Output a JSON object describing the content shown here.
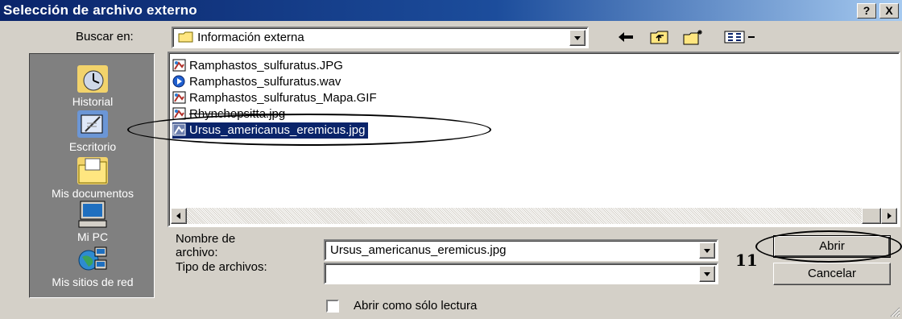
{
  "window": {
    "title": "Selección de archivo externo",
    "help_label": "?",
    "close_label": "X"
  },
  "look_in": {
    "label": "Buscar en:",
    "value": "Información externa"
  },
  "toolbar": {
    "back_icon": "back-arrow-icon",
    "up_icon": "up-folder-icon",
    "new_folder_icon": "new-folder-icon",
    "view_icon": "view-menu-icon"
  },
  "places": [
    {
      "label": "Historial",
      "icon": "history-icon"
    },
    {
      "label": "Escritorio",
      "icon": "desktop-icon"
    },
    {
      "label": "Mis documentos",
      "icon": "my-documents-icon"
    },
    {
      "label": "Mi PC",
      "icon": "my-computer-icon"
    },
    {
      "label": "Mis sitios de red",
      "icon": "network-places-icon"
    }
  ],
  "files": [
    {
      "name": "Ramphastos_sulfuratus.JPG",
      "type": "image",
      "selected": false
    },
    {
      "name": "Ramphastos_sulfuratus.wav",
      "type": "audio",
      "selected": false
    },
    {
      "name": "Ramphastos_sulfuratus_Mapa.GIF",
      "type": "image",
      "selected": false
    },
    {
      "name": "Rhynchopsitta.jpg",
      "type": "image",
      "selected": false
    },
    {
      "name": "Ursus_americanus_eremicus.jpg",
      "type": "image",
      "selected": true
    }
  ],
  "filename": {
    "label_line1": "Nombre de",
    "label_line2": "archivo:",
    "value": "Ursus_americanus_eremicus.jpg"
  },
  "filetype": {
    "label": "Tipo de archivos:",
    "value": ""
  },
  "buttons": {
    "open": "Abrir",
    "cancel": "Cancelar"
  },
  "readonly": {
    "label": "Abrir como sólo lectura",
    "checked": false
  },
  "annotation_step": "11",
  "colors": {
    "title_bar": "#0a246a",
    "selection": "#0a246a",
    "face": "#d4d0c8"
  }
}
